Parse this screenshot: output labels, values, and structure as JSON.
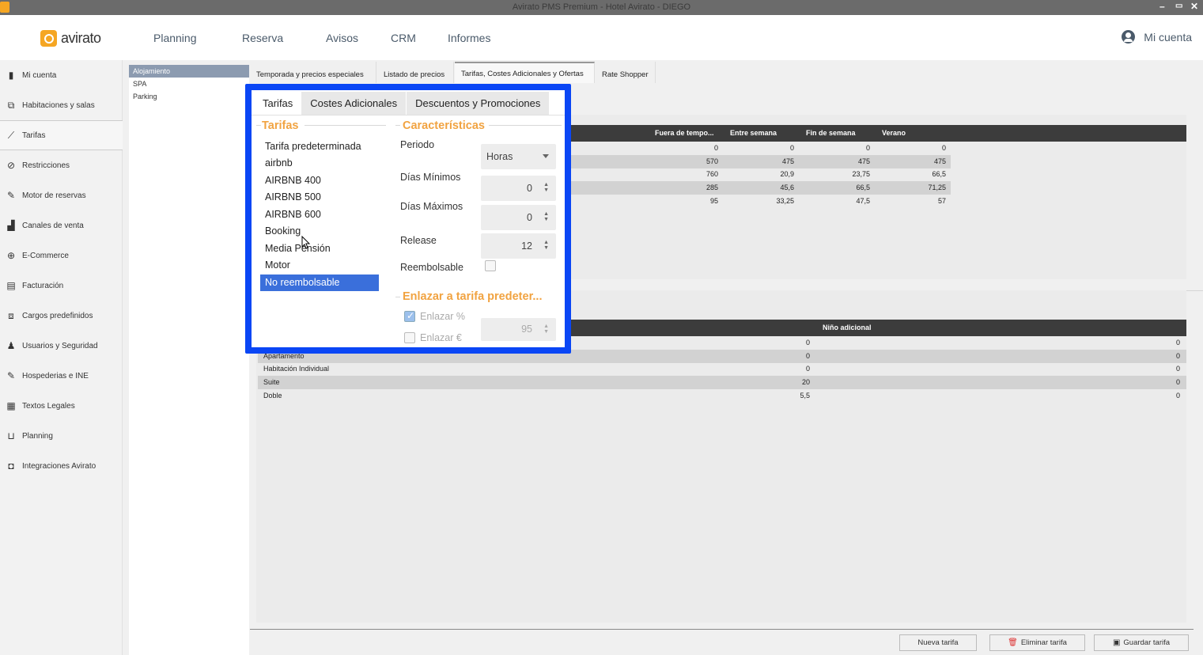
{
  "window": {
    "title": "Avirato PMS Premium - Hotel Avirato - DIEGO",
    "controls": [
      "–",
      "▭",
      "✕"
    ]
  },
  "header": {
    "logo_text": "avirato",
    "nav": [
      "Planning",
      "Reserva",
      "Avisos",
      "CRM",
      "Informes"
    ],
    "account_label": "Mi cuenta"
  },
  "sidebar": {
    "items": [
      {
        "label": "Mi cuenta",
        "icon": "building-icon"
      },
      {
        "label": "Habitaciones y salas",
        "icon": "rooms-icon"
      },
      {
        "label": "Tarifas",
        "icon": "chart-icon"
      },
      {
        "label": "Restricciones",
        "icon": "ban-icon"
      },
      {
        "label": "Motor de reservas",
        "icon": "edit-icon"
      },
      {
        "label": "Canales de venta",
        "icon": "bar-chart-icon"
      },
      {
        "label": "E-Commerce",
        "icon": "plus-circle-icon"
      },
      {
        "label": "Facturación",
        "icon": "invoice-icon"
      },
      {
        "label": "Cargos predefinidos",
        "icon": "charges-icon"
      },
      {
        "label": "Usuarios y Seguridad",
        "icon": "user-lock-icon"
      },
      {
        "label": "Hospederias e INE",
        "icon": "edit-icon"
      },
      {
        "label": "Textos Legales",
        "icon": "document-icon"
      },
      {
        "label": "Planning",
        "icon": "planning-icon"
      },
      {
        "label": "Integraciones Avirato",
        "icon": "integration-icon"
      }
    ],
    "active": "Tarifas"
  },
  "categories": [
    "Alojamiento",
    "SPA",
    "Parking"
  ],
  "top_tabs": [
    "Temporada y precios especiales",
    "Listado de precios",
    "Tarifas, Costes Adicionales y Ofertas",
    "Rate Shopper"
  ],
  "upper_table": {
    "headers": [
      "Fuera de tempo...",
      "Entre semana",
      "Fin de semana",
      "Verano"
    ],
    "rows": [
      [
        "0",
        "0",
        "0",
        "0"
      ],
      [
        "570",
        "475",
        "475",
        "475"
      ],
      [
        "760",
        "20,9",
        "23,75",
        "66,5"
      ],
      [
        "285",
        "45,6",
        "66,5",
        "71,25"
      ],
      [
        "95",
        "33,25",
        "47,5",
        "57"
      ]
    ]
  },
  "lower_table": {
    "header": "Niño adicional",
    "rows": [
      {
        "name": "",
        "mid": "0",
        "right": "0"
      },
      {
        "name": "Apartamento",
        "mid": "0",
        "right": "0"
      },
      {
        "name": "Habitación Individual",
        "mid": "0",
        "right": "0"
      },
      {
        "name": "Suite",
        "mid": "20",
        "right": "0"
      },
      {
        "name": "Doble",
        "mid": "5,5",
        "right": "0"
      }
    ]
  },
  "buttons": {
    "new": "Nueva tarifa",
    "delete": "Eliminar tarifa",
    "save": "Guardar tarifa"
  },
  "dialog": {
    "tabs": [
      "Tarifas",
      "Costes Adicionales",
      "Descuentos y Promociones"
    ],
    "tarifas_title": "Tarifas",
    "tarifas": [
      "Tarifa predeterminada",
      "airbnb",
      "AIRBNB 400",
      "AIRBNB 500",
      "AIRBNB 600",
      "Booking",
      "Media Pensión",
      "Motor",
      "No reembolsable"
    ],
    "selected_tarifa": "No reembolsable",
    "caracteristicas_title": "Características",
    "periodo_label": "Periodo",
    "periodo_value": "Horas",
    "dias_minimos_label": "Días Mínimos",
    "dias_minimos_value": "0",
    "dias_maximos_label": "Días Máximos",
    "dias_maximos_value": "0",
    "release_label": "Release",
    "release_value": "12",
    "reembolsable_label": "Reembolsable",
    "enlazar_title": "Enlazar a tarifa predeter...",
    "enlazar_pct_label": "Enlazar %",
    "enlazar_eur_label": "Enlazar €",
    "enlazar_value": "95"
  },
  "colors": {
    "accent": "#f1a341",
    "highlight_border": "#0a46f5",
    "selection": "#3a6fdb",
    "table_header": "#3c3c3c"
  }
}
